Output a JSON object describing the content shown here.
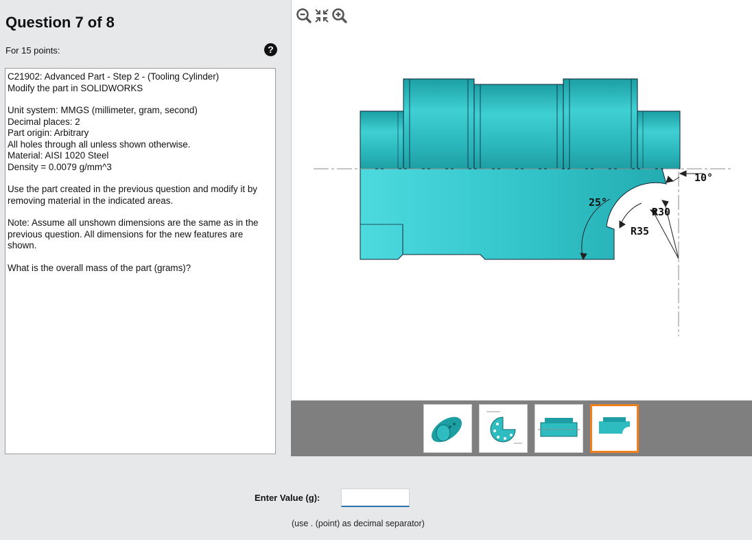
{
  "question": {
    "title": "Question 7 of 8",
    "points": "For 15 points:",
    "help_icon": "question-circle-icon",
    "lines": [
      "C21902:  Advanced Part - Step 2 - (Tooling Cylinder)",
      "Modify the part in SOLIDWORKS",
      "",
      "Unit system: MMGS (millimeter, gram, second)",
      "Decimal places: 2",
      "Part origin: Arbitrary",
      "All holes through all unless shown otherwise.",
      "Material: AISI 1020 Steel",
      "Density = 0.0079 g/mm^3",
      "",
      "Use the part created in the previous question and modify it by removing material in the indicated areas.",
      "",
      "Note: Assume all unshown dimensions are the same as in the previous question.  All dimensions for the new features are shown.",
      "",
      "What is the overall mass of the part (grams)?"
    ]
  },
  "viewer": {
    "toolbar": [
      "zoom-out-icon",
      "fit-to-view-icon",
      "zoom-in-icon"
    ],
    "dimensions": {
      "angle_small": "10°",
      "angle_large": "25°",
      "radius_inner": "R30",
      "radius_outer": "R35"
    },
    "thumbnails": [
      {
        "name": "thumbnail-isometric-view",
        "active": false
      },
      {
        "name": "thumbnail-end-view-drawing",
        "active": false
      },
      {
        "name": "thumbnail-side-view",
        "active": false
      },
      {
        "name": "thumbnail-modified-side-view",
        "active": true
      }
    ]
  },
  "answer": {
    "label": "Enter Value (g):",
    "value": "",
    "note": "(use . (point) as decimal separator)"
  },
  "colors": {
    "part_fill": "#2fbcc0",
    "part_dark": "#1a8d91",
    "part_light": "#5fdbe0",
    "thumb_active_border": "#f07f1e",
    "input_underline": "#2a6fb0"
  }
}
